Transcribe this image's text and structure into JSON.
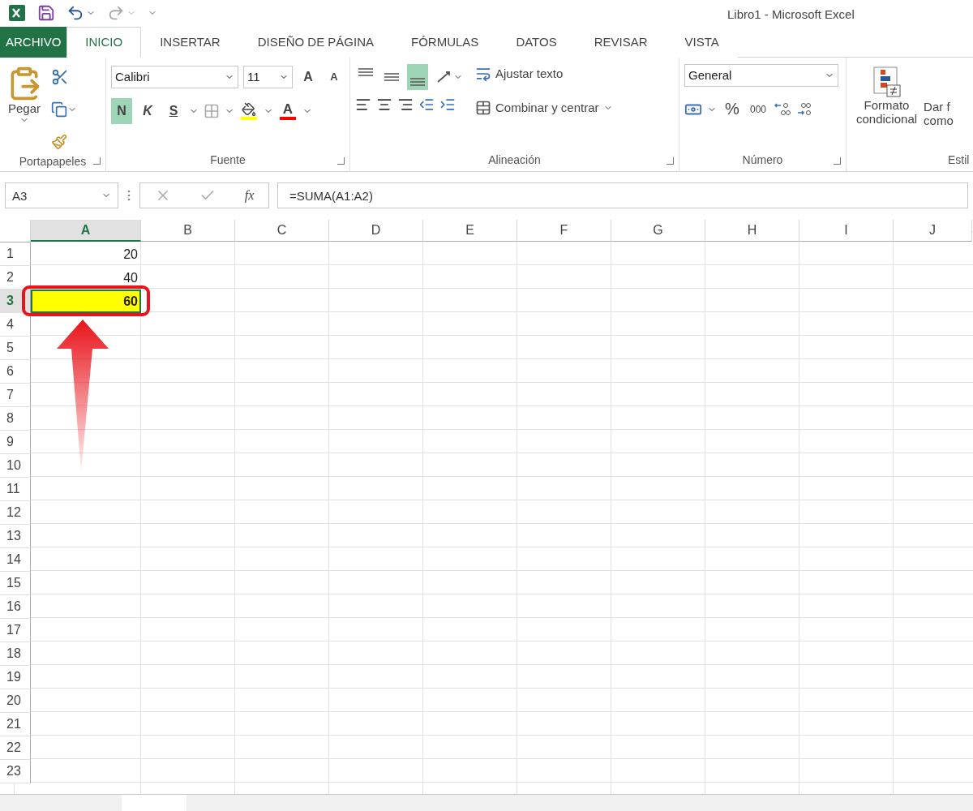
{
  "title_bar": {
    "title": "Libro1 - Microsoft Excel"
  },
  "ribbon_tabs": [
    {
      "label": "ARCHIVO",
      "kind": "file",
      "selected": false
    },
    {
      "label": "INICIO",
      "kind": "tab",
      "selected": true
    },
    {
      "label": "INSERTAR",
      "kind": "tab",
      "selected": false
    },
    {
      "label": "DISEÑO DE PÁGINA",
      "kind": "tab",
      "selected": false
    },
    {
      "label": "FÓRMULAS",
      "kind": "tab",
      "selected": false
    },
    {
      "label": "DATOS",
      "kind": "tab",
      "selected": false
    },
    {
      "label": "REVISAR",
      "kind": "tab",
      "selected": false
    },
    {
      "label": "VISTA",
      "kind": "tab",
      "selected": false
    }
  ],
  "clipboard": {
    "paste_label": "Pegar",
    "group_label": "Portapapeles"
  },
  "font": {
    "font_name": "Calibri",
    "font_size": "11",
    "grow_label": "A",
    "shrink_label": "A",
    "bold_label": "N",
    "bold_on": true,
    "italic_label": "K",
    "underline_label": "S",
    "font_color_label": "A",
    "group_label": "Fuente"
  },
  "alignment": {
    "vertical": [
      {
        "kind": "top",
        "selected": false
      },
      {
        "kind": "middle",
        "selected": false
      },
      {
        "kind": "bottom",
        "selected": true
      }
    ],
    "wrap_label": "Ajustar texto",
    "merge_label": "Combinar y centrar",
    "group_label": "Alineación"
  },
  "number": {
    "format": "General",
    "percent_label": "%",
    "thousands_label": "000",
    "group_label": "Número"
  },
  "styles": {
    "conditional_lines": [
      "Formato",
      "condicional"
    ],
    "table_lines": [
      "Dar f",
      "como"
    ],
    "group_label": "Estil"
  },
  "formula_bar": {
    "name_box": "A3",
    "function_label": "fx",
    "formula": "=SUMA(A1:A2)"
  },
  "sheet": {
    "columns": [
      {
        "label": "A",
        "selected": true
      },
      {
        "label": "B",
        "selected": false
      },
      {
        "label": "C",
        "selected": false
      },
      {
        "label": "D",
        "selected": false
      },
      {
        "label": "E",
        "selected": false
      },
      {
        "label": "F",
        "selected": false
      },
      {
        "label": "G",
        "selected": false
      },
      {
        "label": "H",
        "selected": false
      },
      {
        "label": "I",
        "selected": false
      },
      {
        "label": "J",
        "selected": false
      }
    ],
    "rows": [
      {
        "number": "1",
        "selected": false,
        "cells": [
          {
            "value": "20",
            "highlighted": false
          }
        ]
      },
      {
        "number": "2",
        "selected": false,
        "cells": [
          {
            "value": "40",
            "highlighted": false
          }
        ]
      },
      {
        "number": "3",
        "selected": true,
        "cells": [
          {
            "value": "60",
            "highlighted": true
          }
        ]
      },
      {
        "number": "4",
        "selected": false
      },
      {
        "number": "5",
        "selected": false
      },
      {
        "number": "6",
        "selected": false
      },
      {
        "number": "7",
        "selected": false
      },
      {
        "number": "8",
        "selected": false
      },
      {
        "number": "9",
        "selected": false
      },
      {
        "number": "10",
        "selected": false
      },
      {
        "number": "11",
        "selected": false
      },
      {
        "number": "12",
        "selected": false
      },
      {
        "number": "13",
        "selected": false
      },
      {
        "number": "14",
        "selected": false
      },
      {
        "number": "15",
        "selected": false
      },
      {
        "number": "16",
        "selected": false
      },
      {
        "number": "17",
        "selected": false
      },
      {
        "number": "18",
        "selected": false
      },
      {
        "number": "19",
        "selected": false
      },
      {
        "number": "20",
        "selected": false
      },
      {
        "number": "21",
        "selected": false
      },
      {
        "number": "22",
        "selected": false
      },
      {
        "number": "23",
        "selected": false
      }
    ]
  }
}
